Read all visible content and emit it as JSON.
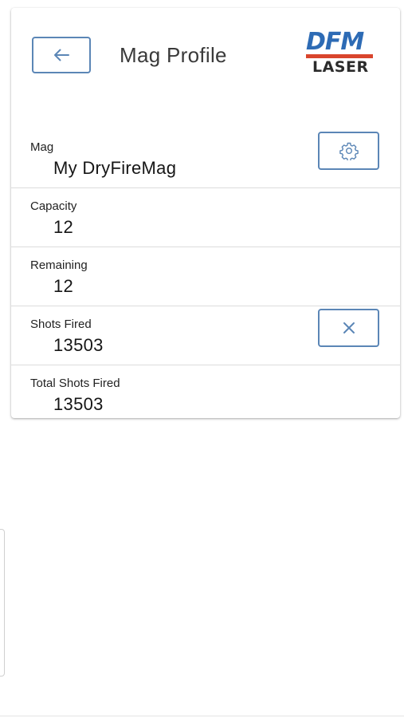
{
  "header": {
    "title": "Mag Profile",
    "logo_top": "DFM",
    "logo_bottom": "LASER"
  },
  "fields": [
    {
      "label": "Mag",
      "value": "My DryFireMag"
    },
    {
      "label": "Capacity",
      "value": "12"
    },
    {
      "label": "Remaining",
      "value": "12"
    },
    {
      "label": "Shots Fired",
      "value": "13503"
    },
    {
      "label": "Total Shots Fired",
      "value": "13503"
    }
  ],
  "icons": {
    "back": "arrow-left-icon",
    "settings": "gear-icon",
    "reset": "close-icon"
  },
  "colors": {
    "accent": "#5b86b6",
    "logo_blue": "#2d6bb5",
    "logo_red": "#d9452d"
  }
}
